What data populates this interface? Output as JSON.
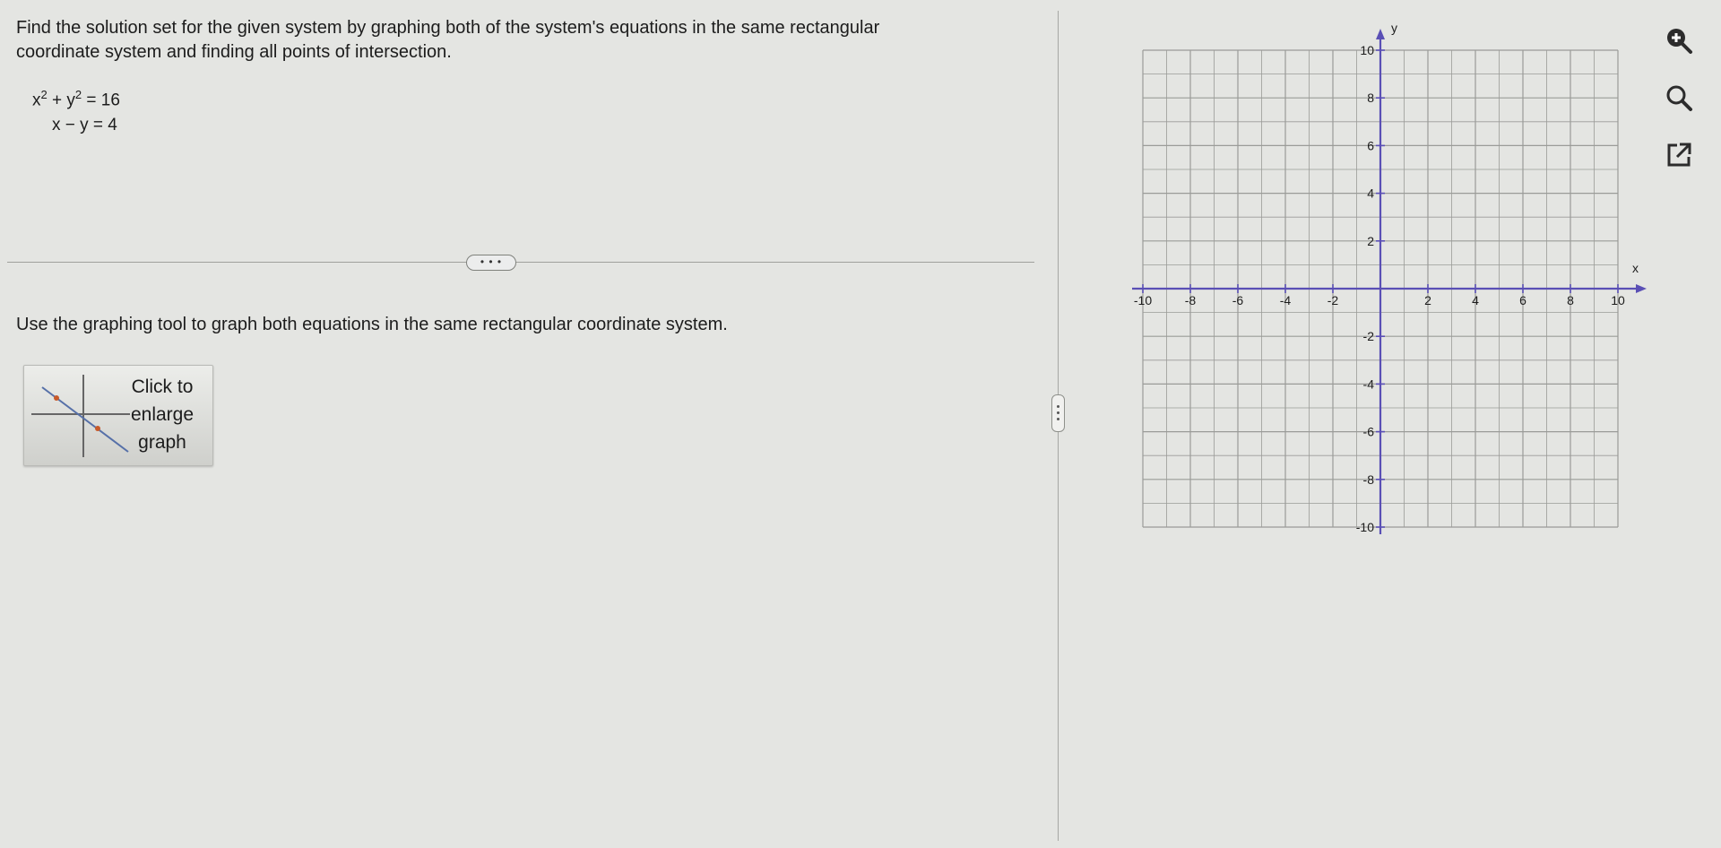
{
  "question": {
    "prompt": "Find the solution set for the given system by graphing both of the system's equations in the same rectangular coordinate system and finding all points of intersection.",
    "equation1": {
      "x_part": "x",
      "x_exp": "2",
      "plus": "+",
      "y_part": "y",
      "y_exp": "2",
      "rhs": "= 16"
    },
    "equation2": "x − y = 4"
  },
  "more_button_label": "• • •",
  "instruction": "Use the graphing tool to graph both equations in the same rectangular coordinate system.",
  "enlarge_button": {
    "label": "Click to enlarge graph"
  },
  "graph": {
    "x_axis_label": "x",
    "y_axis_label": "y",
    "x_ticks": [
      "-10",
      "-8",
      "-6",
      "-4",
      "-2",
      "2",
      "4",
      "6",
      "8",
      "10"
    ],
    "y_ticks": [
      "10",
      "8",
      "6",
      "4",
      "2",
      "-2",
      "-4",
      "-6",
      "-8",
      "-10"
    ],
    "range": {
      "xmin": -10,
      "xmax": 10,
      "ymin": -10,
      "ymax": 10
    },
    "grid": true
  },
  "tools": {
    "zoom_in_icon": "zoom-in-icon",
    "zoom_out_icon": "zoom-out-icon",
    "popout_icon": "external-link-icon"
  },
  "colors": {
    "axis": "#5a4fb5",
    "grid": "#9a9b98",
    "background": "#e4e5e2",
    "ink": "#1c1c1c"
  }
}
